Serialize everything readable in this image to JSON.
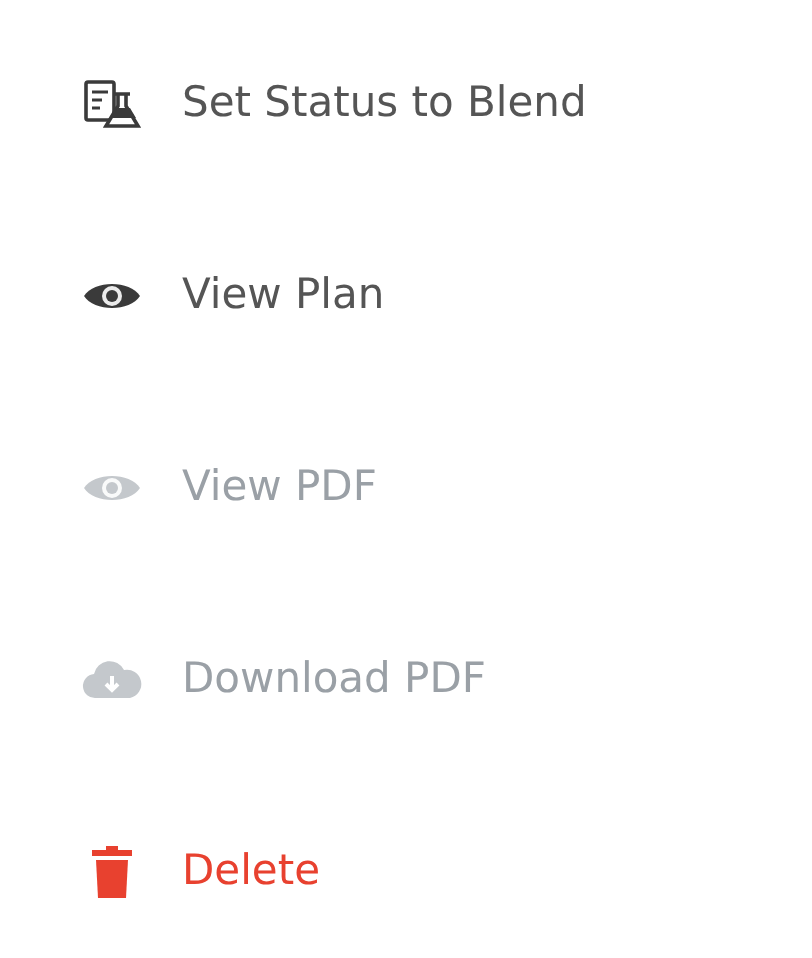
{
  "menu": {
    "items": [
      {
        "label": "Set Status to Blend",
        "kind": "blend",
        "disabled": false
      },
      {
        "label": "View Plan",
        "kind": "view",
        "disabled": false
      },
      {
        "label": "View PDF",
        "kind": "view",
        "disabled": true
      },
      {
        "label": "Download PDF",
        "kind": "download",
        "disabled": true
      },
      {
        "label": "Delete",
        "kind": "delete",
        "disabled": false
      }
    ]
  }
}
